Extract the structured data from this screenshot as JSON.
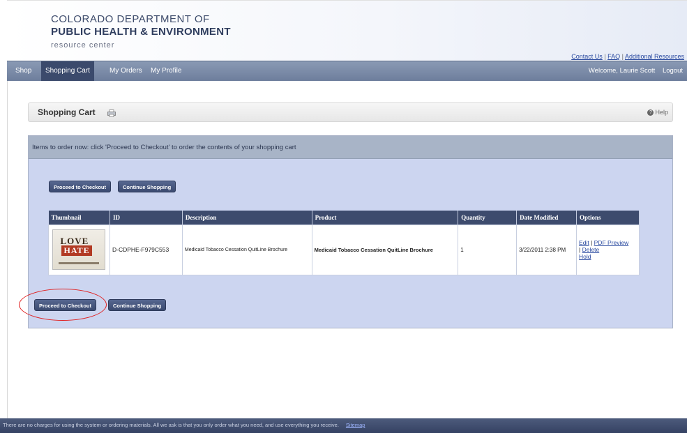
{
  "header": {
    "logo_line1": "COLORADO DEPARTMENT OF",
    "logo_line2": "PUBLIC HEALTH & ENVIRONMENT",
    "logo_line3": "resource center",
    "links": [
      "Contact Us",
      "FAQ",
      "Additional Resources"
    ]
  },
  "nav": {
    "items": [
      "Shop",
      "Shopping Cart",
      "My Orders",
      "My Profile"
    ],
    "active": "Shopping Cart",
    "welcome": "Welcome, Laurie Scott",
    "logout": "Logout"
  },
  "page": {
    "title": "Shopping Cart",
    "help": "Help",
    "print_icon": "printer-icon",
    "help_icon": "help-circle-icon"
  },
  "panel": {
    "instructions": "Items to order now: click 'Proceed to Checkout' to order the contents of your shopping cart",
    "proceed_label": "Proceed to Checkout",
    "continue_label": "Continue Shopping"
  },
  "table": {
    "headers": [
      "Thumbnail",
      "ID",
      "Description",
      "Product",
      "Quantity",
      "Date Modified",
      "Options"
    ],
    "rows": [
      {
        "thumbnail_text_1": "LOVE",
        "thumbnail_text_2": "HATE",
        "id": "D-CDPHE-F979C553",
        "description": "Medicaid Tobacco Cessation QuitLine Brochure",
        "product": "Medicaid Tobacco Cessation QuitLine Brochure",
        "quantity": "1",
        "date_modified": "3/22/2011 2:38 PM",
        "options": {
          "edit": "Edit",
          "pdf_preview": "PDF Preview",
          "delete": "Delete",
          "hold": "Hold"
        }
      }
    ]
  },
  "footer": {
    "text": "There are no charges for using the system or ordering materials. All we ask is that you only order what you need, and use everything you receive.",
    "sitemap": "Sitemap"
  },
  "colors": {
    "nav_bg": "#7b8ba8",
    "nav_active": "#3b4a6c",
    "button_bg": "#3b4a70",
    "panel_bg": "#ccd5f0",
    "highlight_oval": "#e02020"
  }
}
